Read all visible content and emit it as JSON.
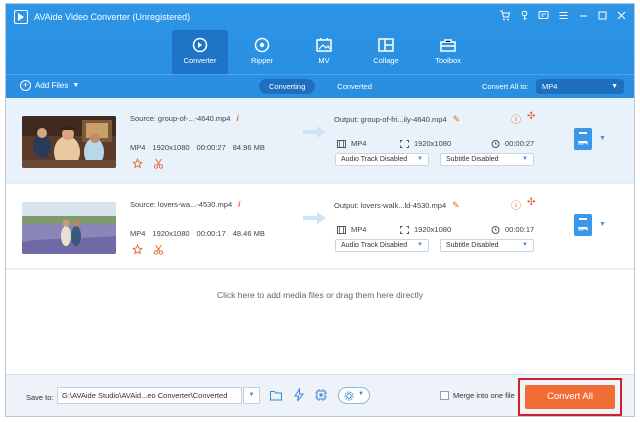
{
  "app": {
    "title": "AVAide Video Converter (Unregistered)"
  },
  "colors": {
    "header_blue": "#2a8fe0",
    "active_tab": "#1f74c7",
    "accent_orange": "#f26d35",
    "highlight_red": "#d0202a"
  },
  "nav": {
    "items": [
      {
        "label": "Converter",
        "icon": "converter-icon",
        "active": true
      },
      {
        "label": "Ripper",
        "icon": "ripper-icon",
        "active": false
      },
      {
        "label": "MV",
        "icon": "mv-icon",
        "active": false
      },
      {
        "label": "Collage",
        "icon": "collage-icon",
        "active": false
      },
      {
        "label": "Toolbox",
        "icon": "toolbox-icon",
        "active": false
      }
    ]
  },
  "toolbar": {
    "add_files": "Add Files",
    "tabs": [
      "Converting",
      "Converted"
    ],
    "active_tab": "Converting",
    "convert_all_to": "Convert All to:",
    "format": "MP4"
  },
  "files": [
    {
      "source": "Source: group-of-...-4640.mp4",
      "format": "MP4",
      "resolution": "1920x1080",
      "duration": "00:00:27",
      "size": "84.96 MB",
      "output": "Output: group-of-fri...ily-4640.mp4",
      "out_format": "MP4",
      "out_resolution": "1920x1080",
      "out_duration": "00:00:27",
      "audio_track": "Audio Track Disabled",
      "subtitle": "Subtitle Disabled",
      "badge": "MP4"
    },
    {
      "source": "Source: lovers-wa...-4530.mp4",
      "format": "MP4",
      "resolution": "1920x1080",
      "duration": "00:00:17",
      "size": "48.46 MB",
      "output": "Output: lovers-walk...ld-4530.mp4",
      "out_format": "MP4",
      "out_resolution": "1920x1080",
      "out_duration": "00:00:17",
      "audio_track": "Audio Track Disabled",
      "subtitle": "Subtitle Disabled",
      "badge": "MP4"
    }
  ],
  "drop_hint": "Click here to add media files or drag them here directly",
  "bottom": {
    "save_to": "Save to:",
    "path": "G:\\AVAide Studio\\AVAid...eo Converter\\Converted",
    "merge_label": "Merge into one file",
    "convert_all": "Convert All"
  }
}
